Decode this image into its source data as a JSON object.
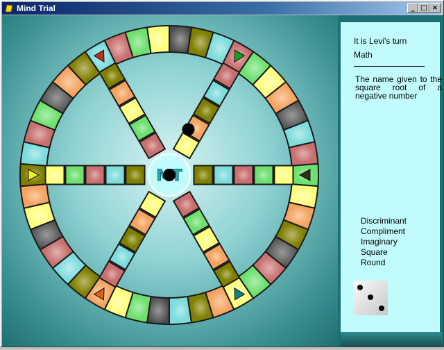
{
  "window": {
    "title": "Mind Trial"
  },
  "titlebar_buttons": {
    "minimize": "_",
    "maximize": "□",
    "close": "×"
  },
  "center": {
    "label": "MT"
  },
  "info": {
    "turn": "It is Levi's turn",
    "category": "Math",
    "question": "The name given to the square root of a negative number"
  },
  "answers": [
    "Discriminant",
    "Compliment",
    "Imaginary",
    "Square",
    "Round"
  ],
  "dice": {
    "value": 3
  },
  "colors": {
    "orange": "#f4a460",
    "olive": "#808000",
    "cyan": "#7fdcdc",
    "pink": "#c87070",
    "green": "#6ee06e",
    "yellow": "#ffff80",
    "frame": "#1c6f72",
    "panel": "#c2fbfb"
  }
}
